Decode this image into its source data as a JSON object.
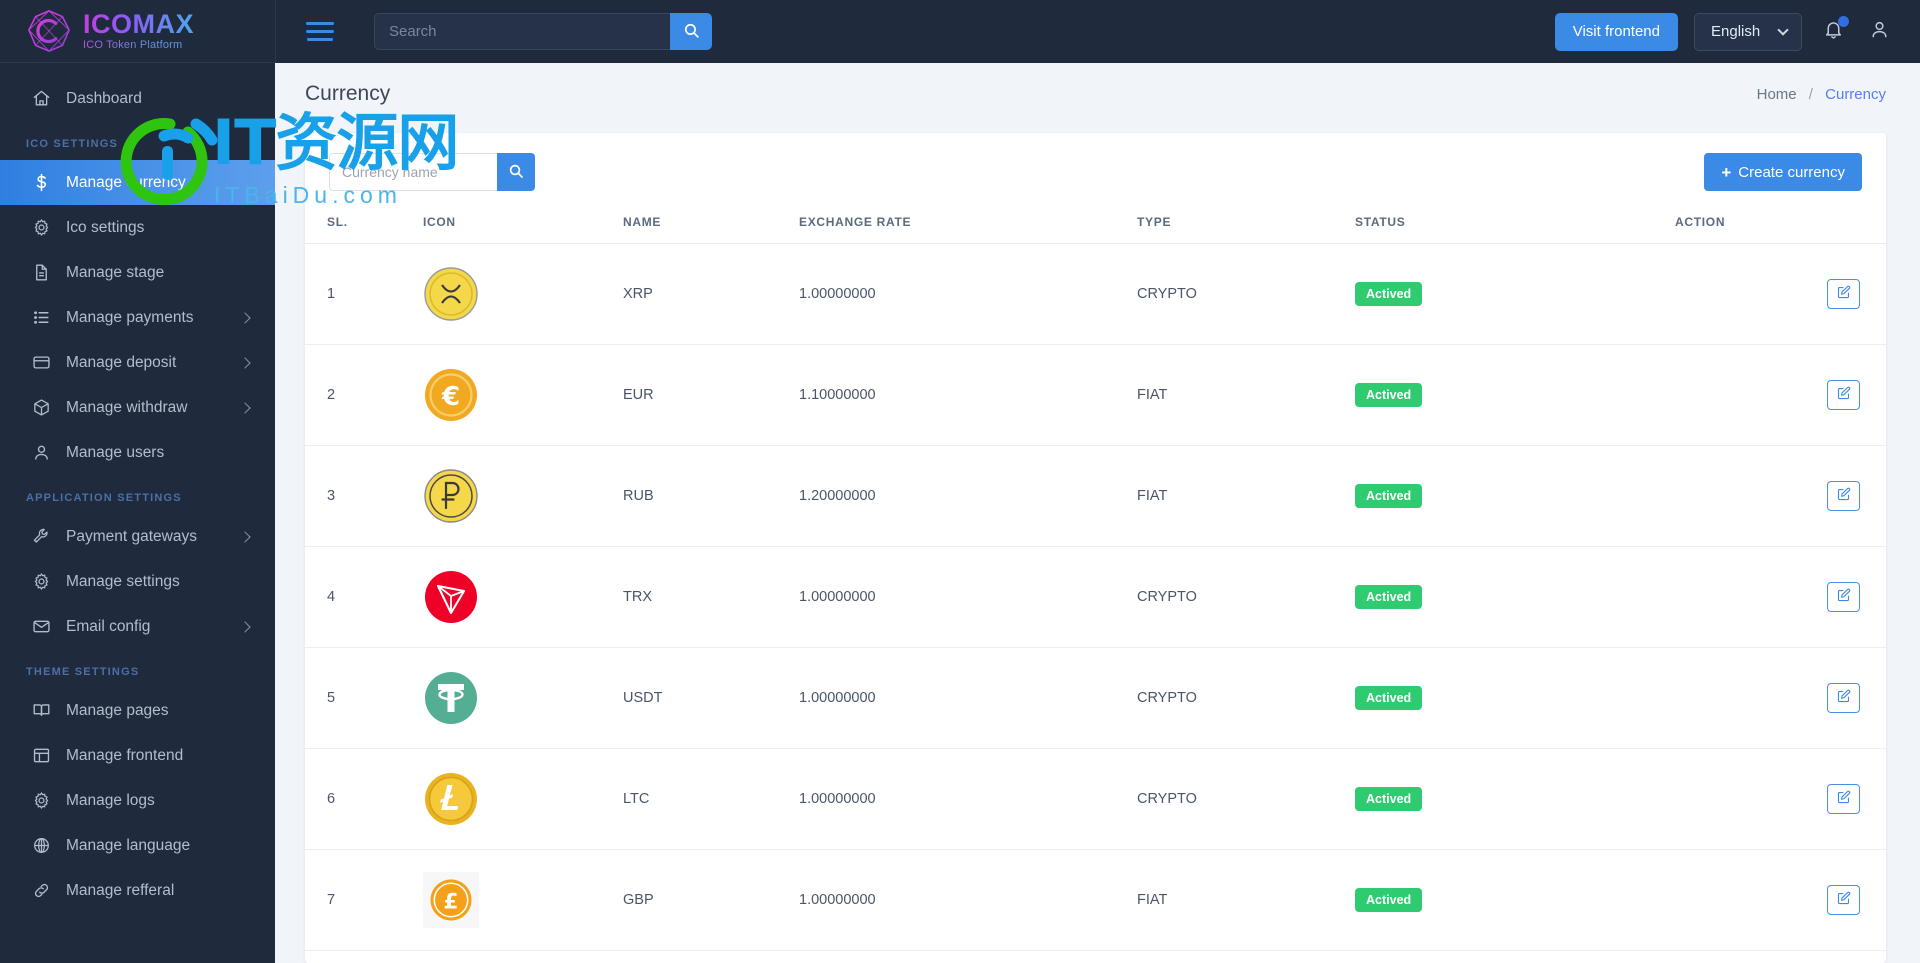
{
  "brand": {
    "title": "ICOMAX",
    "subtitle": "ICO Token Platform",
    "logo_icon": "icomax-gem-logo"
  },
  "sidebar": {
    "items": [
      {
        "label": "Dashboard",
        "icon": "home-icon",
        "active": false,
        "caret": false,
        "section": null
      },
      {
        "label": "ICO SETTINGS",
        "type": "section"
      },
      {
        "label": "Manage currency",
        "icon": "dollar-icon",
        "active": true,
        "caret": false
      },
      {
        "label": "Ico settings",
        "icon": "gear-icon",
        "active": false,
        "caret": false
      },
      {
        "label": "Manage stage",
        "icon": "document-icon",
        "active": false,
        "caret": false
      },
      {
        "label": "Manage payments",
        "icon": "list-icon",
        "active": false,
        "caret": true
      },
      {
        "label": "Manage deposit",
        "icon": "credit-card-icon",
        "active": false,
        "caret": true
      },
      {
        "label": "Manage withdraw",
        "icon": "box-icon",
        "active": false,
        "caret": true
      },
      {
        "label": "Manage users",
        "icon": "user-icon",
        "active": false,
        "caret": false
      },
      {
        "label": "APPLICATION SETTINGS",
        "type": "section"
      },
      {
        "label": "Payment gateways",
        "icon": "wrench-icon",
        "active": false,
        "caret": true
      },
      {
        "label": "Manage settings",
        "icon": "gear-icon",
        "active": false,
        "caret": false
      },
      {
        "label": "Email config",
        "icon": "envelope-icon",
        "active": false,
        "caret": true
      },
      {
        "label": "THEME SETTINGS",
        "type": "section"
      },
      {
        "label": "Manage pages",
        "icon": "book-icon",
        "active": false,
        "caret": false
      },
      {
        "label": "Manage frontend",
        "icon": "layout-icon",
        "active": false,
        "caret": false
      },
      {
        "label": "Manage logs",
        "icon": "gear-icon",
        "active": false,
        "caret": false
      },
      {
        "label": "Manage language",
        "icon": "globe-icon",
        "active": false,
        "caret": false
      },
      {
        "label": "Manage refferal",
        "icon": "link-icon",
        "active": false,
        "caret": false
      }
    ]
  },
  "topbar": {
    "menu_icon": "hamburger-icon",
    "search_placeholder": "Search",
    "search_value": "",
    "search_button_icon": "search-icon",
    "visit_frontend_label": "Visit frontend",
    "language_selected": "English",
    "language_options": [
      "English"
    ],
    "notification_icon": "bell-icon",
    "notification_badge": "",
    "profile_icon": "user-icon"
  },
  "page": {
    "title": "Currency",
    "breadcrumb_home": "Home",
    "breadcrumb_separator": "/",
    "breadcrumb_current": "Currency"
  },
  "toolbar": {
    "search_placeholder": "Currency name",
    "search_value": "",
    "search_button_icon": "search-icon",
    "create_label": "Create currency",
    "create_plus": "+"
  },
  "table": {
    "headers": [
      "SL.",
      "ICON",
      "NAME",
      "EXCHANGE RATE",
      "TYPE",
      "STATUS",
      "ACTION"
    ],
    "rows": [
      {
        "sl": "1",
        "icon": "xrp-coin-icon",
        "name": "XRP",
        "rate": "1.00000000",
        "type": "CRYPTO",
        "status": "Actived",
        "action_icon": "edit-icon"
      },
      {
        "sl": "2",
        "icon": "eur-coin-icon",
        "name": "EUR",
        "rate": "1.10000000",
        "type": "FIAT",
        "status": "Actived",
        "action_icon": "edit-icon"
      },
      {
        "sl": "3",
        "icon": "rub-coin-icon",
        "name": "RUB",
        "rate": "1.20000000",
        "type": "FIAT",
        "status": "Actived",
        "action_icon": "edit-icon"
      },
      {
        "sl": "4",
        "icon": "trx-coin-icon",
        "name": "TRX",
        "rate": "1.00000000",
        "type": "CRYPTO",
        "status": "Actived",
        "action_icon": "edit-icon"
      },
      {
        "sl": "5",
        "icon": "usdt-coin-icon",
        "name": "USDT",
        "rate": "1.00000000",
        "type": "CRYPTO",
        "status": "Actived",
        "action_icon": "edit-icon"
      },
      {
        "sl": "6",
        "icon": "ltc-coin-icon",
        "name": "LTC",
        "rate": "1.00000000",
        "type": "CRYPTO",
        "status": "Actived",
        "action_icon": "edit-icon"
      },
      {
        "sl": "7",
        "icon": "gbp-coin-icon",
        "name": "GBP",
        "rate": "1.00000000",
        "type": "FIAT",
        "status": "Actived",
        "action_icon": "edit-icon"
      }
    ]
  },
  "watermark": {
    "text": "IT资源网",
    "subtext": "ITBaiDu.com"
  },
  "colors": {
    "accent": "#3b8ae5",
    "sidebar_bg": "#1f2a3d",
    "page_bg": "#f1f4f9",
    "status_green": "#2ecb71",
    "breadcrumb_link": "#5b7cf0"
  }
}
